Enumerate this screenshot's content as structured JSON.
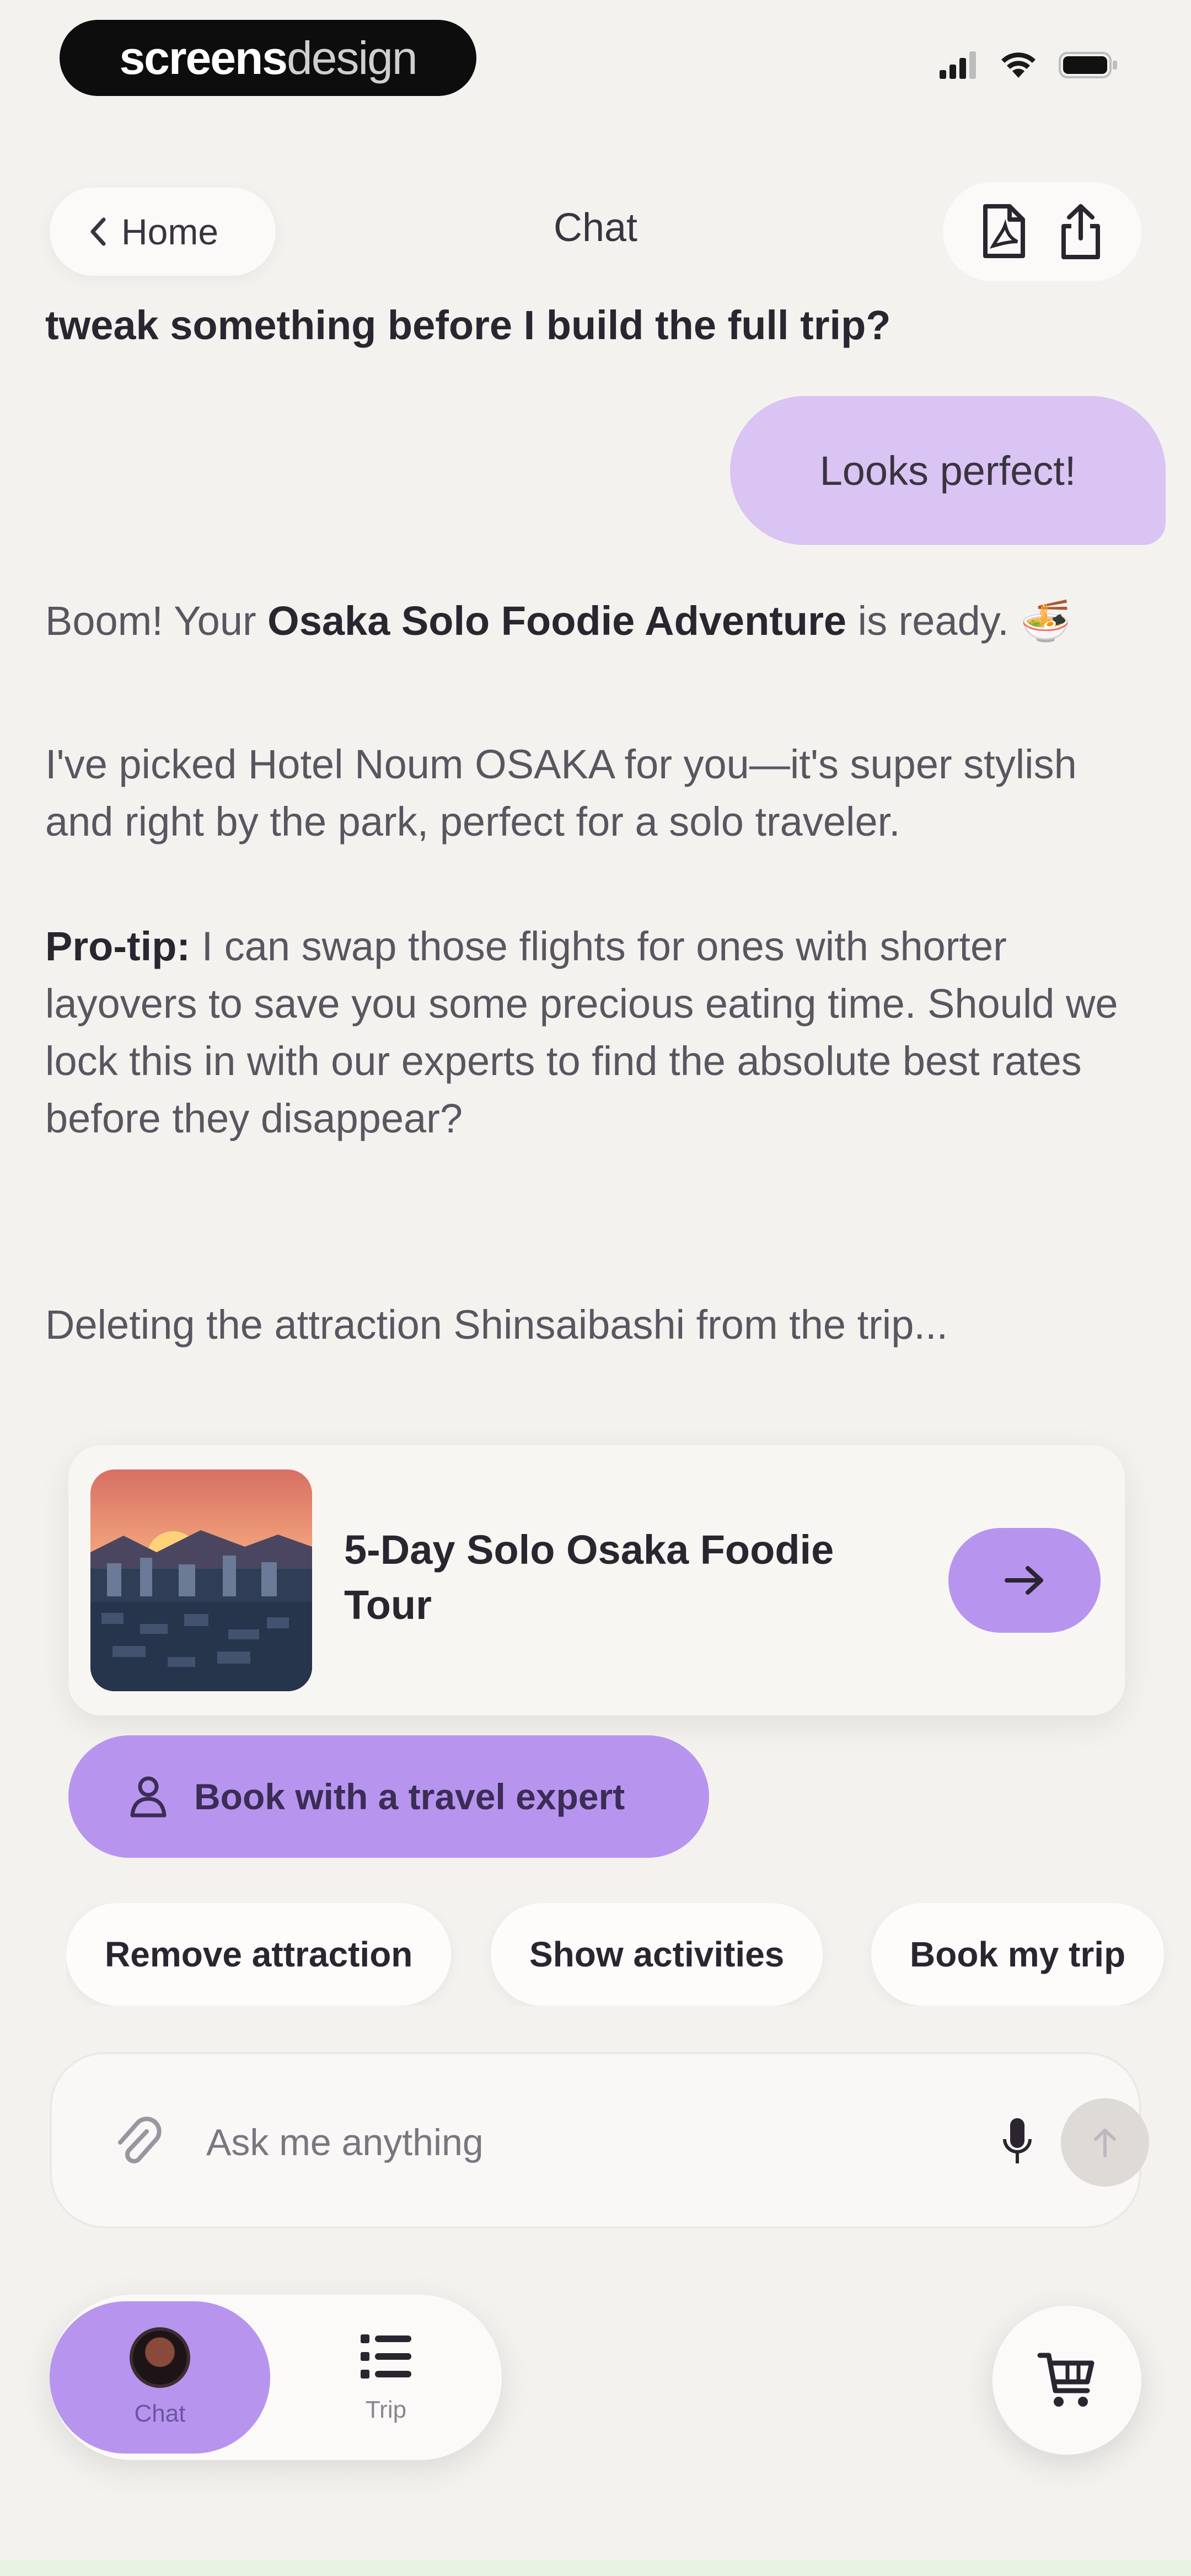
{
  "status_bar": {
    "brand_bold": "screens",
    "brand_light": "design"
  },
  "header": {
    "back_label": "Home",
    "title": "Chat"
  },
  "chat": {
    "prev_assistant_tail": "tweak something before I build the full trip?",
    "user_message": "Looks perfect!",
    "assistant": {
      "p1_prefix": "Boom! Your ",
      "p1_bold": "Osaka Solo Foodie Adventure",
      "p1_suffix": " is ready. 🍜",
      "p2": "I've picked Hotel Noum OSAKA for you—it's super stylish and right by the park, perfect for a solo traveler.",
      "p3_bold": "Pro-tip:",
      "p3_text": " I can swap those flights for ones with shorter layovers to save you some precious eating time. Should we lock this in with our experts to find the absolute best rates before they disappear?"
    },
    "status_message": "Deleting the attraction Shinsaibashi from the trip..."
  },
  "trip_card": {
    "title": "5-Day Solo Osaka Foodie Tour"
  },
  "actions": {
    "book_expert_label": "Book with a travel expert",
    "chips": [
      "Remove attraction",
      "Show activities",
      "Book my trip"
    ]
  },
  "composer": {
    "placeholder": "Ask me anything"
  },
  "nav": {
    "chat_label": "Chat",
    "trip_label": "Trip"
  },
  "colors": {
    "accent": "#b795ef",
    "user_bubble": "#d9c4f3",
    "background": "#f4f2ef"
  }
}
